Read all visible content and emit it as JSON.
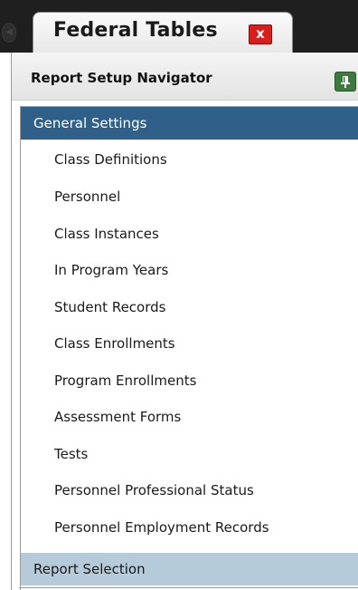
{
  "tab": {
    "title": "Federal Tables",
    "close_glyph": "x",
    "close_icon": "close-icon"
  },
  "navigator": {
    "title": "Report Setup Navigator",
    "pin_icon": "pin-icon"
  },
  "sections": {
    "general": {
      "label": "General Settings",
      "items": [
        "Class Definitions",
        "Personnel",
        "Class Instances",
        "In Program Years",
        "Student Records",
        "Class Enrollments",
        "Program Enrollments",
        "Assessment Forms",
        "Tests",
        "Personnel Professional Status",
        "Personnel Employment Records"
      ]
    },
    "report": {
      "label": "Report Selection"
    }
  },
  "colors": {
    "section_selected": "#2f6089",
    "section_collapsed": "#b5cbd9",
    "close_red": "#d91c1c",
    "pin_green": "#3d7a3d"
  }
}
